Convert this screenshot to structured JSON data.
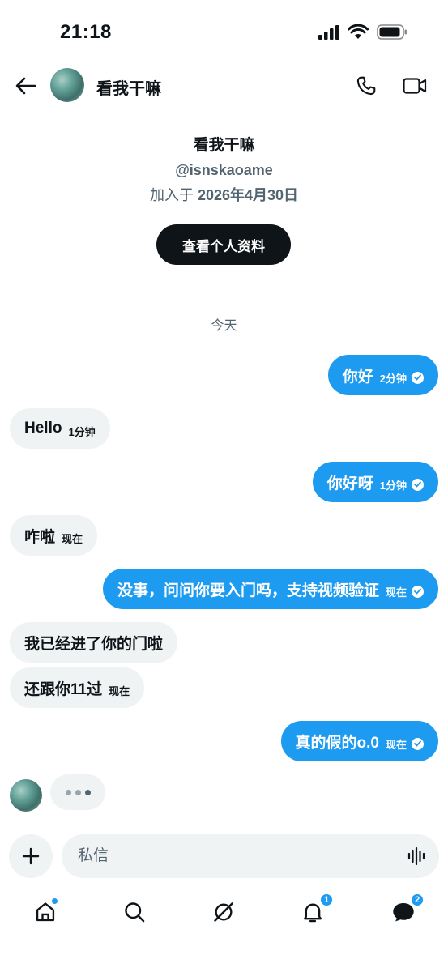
{
  "status_bar": {
    "time": "21:18"
  },
  "header": {
    "contact_name": "看我干嘛"
  },
  "profile": {
    "name": "看我干嘛",
    "handle": "@isnskaoame",
    "joined_prefix": "加入于",
    "joined_date": "2026年4月30日",
    "view_profile_label": "查看个人资料"
  },
  "day_separator": "今天",
  "messages": [
    {
      "direction": "out",
      "text": "你好",
      "time": "2分钟",
      "read": true
    },
    {
      "direction": "in",
      "text": "Hello",
      "time": "1分钟"
    },
    {
      "direction": "out",
      "text": "你好呀",
      "time": "1分钟",
      "read": true
    },
    {
      "direction": "in",
      "text": "咋啦",
      "time": "现在"
    },
    {
      "direction": "out",
      "text": "没事，问问你要入门吗，支持视频验证",
      "time": "现在",
      "read": true
    },
    {
      "direction": "in",
      "text": "我已经进了你的门啦",
      "time": ""
    },
    {
      "direction": "in",
      "text": "还跟你11过",
      "time": "现在"
    },
    {
      "direction": "out",
      "text": "真的假的o.0",
      "time": "现在",
      "read": true
    }
  ],
  "composer": {
    "placeholder": "私信"
  },
  "tabbar": {
    "notifications_badge": "1",
    "messages_badge": "2"
  },
  "colors": {
    "accent": "#1d9bf0",
    "incoming_bubble": "#eff3f4",
    "text": "#0f1419",
    "secondary": "#536471"
  }
}
